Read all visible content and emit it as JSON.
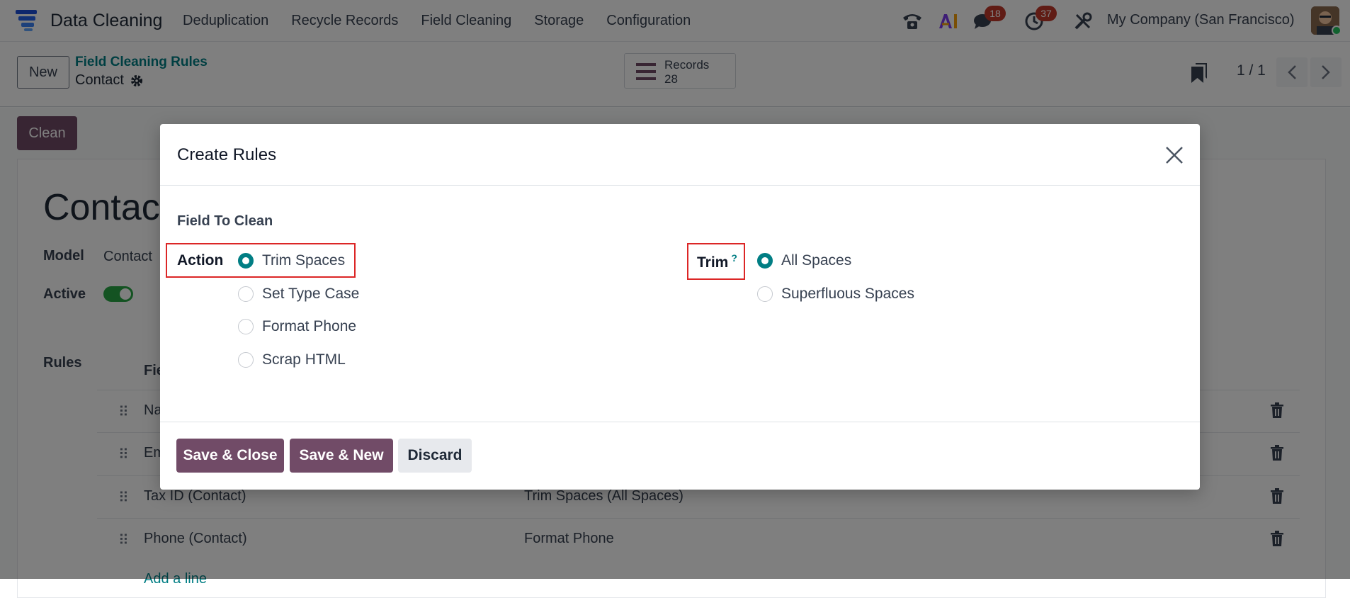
{
  "navbar": {
    "app_name": "Data Cleaning",
    "menu": [
      "Deduplication",
      "Recycle Records",
      "Field Cleaning",
      "Storage",
      "Configuration"
    ],
    "messages_badge": "18",
    "activities_badge": "37",
    "company": "My Company (San Francisco)"
  },
  "control_panel": {
    "new_label": "New",
    "breadcrumb_parent": "Field Cleaning Rules",
    "breadcrumb_current": "Contact",
    "records_label": "Records",
    "records_count": "28",
    "pager": "1 / 1"
  },
  "form": {
    "clean_label": "Clean",
    "title": "Contact",
    "model_label": "Model",
    "model_value": "Contact",
    "active_label": "Active",
    "rules_label": "Rules",
    "rules_header_field": "Fie",
    "rules": [
      {
        "field": "Na",
        "action": ""
      },
      {
        "field": "Em",
        "action": ""
      },
      {
        "field": "Tax ID (Contact)",
        "action": "Trim Spaces (All Spaces)"
      },
      {
        "field": "Phone (Contact)",
        "action": "Format Phone"
      }
    ],
    "add_line": "Add a line"
  },
  "modal": {
    "title": "Create Rules",
    "section_title": "Field To Clean",
    "action_label": "Action",
    "action_options": [
      "Trim Spaces",
      "Set Type Case",
      "Format Phone",
      "Scrap HTML"
    ],
    "action_selected": "Trim Spaces",
    "trim_label": "Trim",
    "trim_help": "?",
    "trim_options": [
      "All Spaces",
      "Superfluous Spaces"
    ],
    "trim_selected": "All Spaces",
    "save_close": "Save & Close",
    "save_new": "Save & New",
    "discard": "Discard"
  },
  "colors": {
    "primary": "#714b67",
    "accent": "#017e84",
    "highlight": "#dc2626",
    "badge": "#c0392b"
  }
}
